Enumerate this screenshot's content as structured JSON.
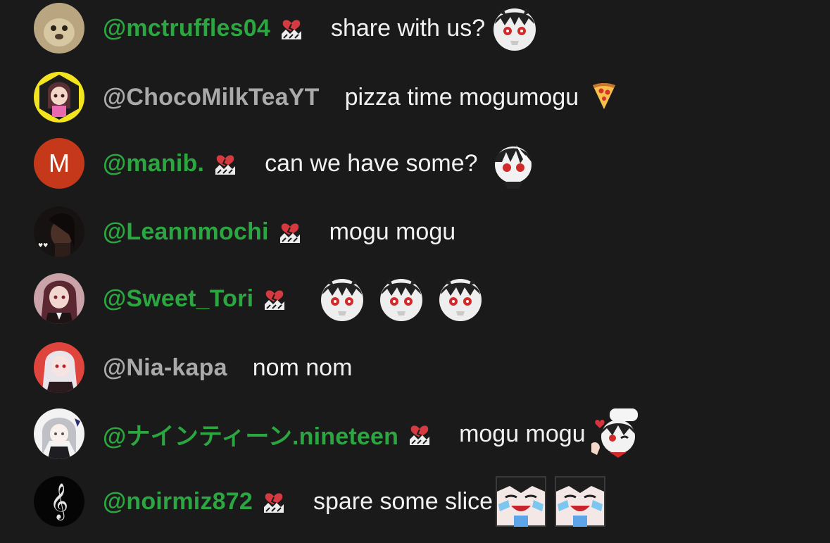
{
  "chat": {
    "messages": [
      {
        "author": "@mctruffles04",
        "author_style": "member",
        "has_badge": true,
        "text": "share with us?",
        "emojis": [
          "chibi-skull-emoji"
        ],
        "avatar": {
          "kind": "photo",
          "color": "#b9a57f"
        }
      },
      {
        "author": "@ChocoMilkTeaYT",
        "author_style": "plain",
        "has_badge": false,
        "text": "pizza time mogumogu",
        "emojis": [
          "pizza-emoji"
        ],
        "avatar": {
          "kind": "anime",
          "color": "#f2e41f"
        }
      },
      {
        "author": "@manib.",
        "author_style": "member",
        "has_badge": true,
        "text": "can we have some?",
        "emojis": [
          "chibi-face-emoji"
        ],
        "avatar": {
          "kind": "letter",
          "letter": "M",
          "color": "#c5391a"
        }
      },
      {
        "author": "@Leannmochi",
        "author_style": "member",
        "has_badge": true,
        "text": "mogu mogu",
        "emojis": [],
        "avatar": {
          "kind": "photo",
          "color": "#2a1c18"
        }
      },
      {
        "author": "@Sweet_Tori",
        "author_style": "member",
        "has_badge": true,
        "text": "",
        "emojis": [
          "chibi-skull-emoji",
          "chibi-skull-emoji",
          "chibi-skull-emoji"
        ],
        "avatar": {
          "kind": "anime",
          "color": "#7d3b3b"
        }
      },
      {
        "author": "@Nia-kapa",
        "author_style": "plain",
        "has_badge": false,
        "text": "nom nom",
        "emojis": [],
        "avatar": {
          "kind": "anime",
          "color": "#e0453d"
        }
      },
      {
        "author": "@ナインティーン.nineteen",
        "author_style": "member",
        "has_badge": true,
        "text": "mogu mogu",
        "emojis": [
          "chibi-chef-emoji"
        ],
        "avatar": {
          "kind": "anime",
          "color": "#cfd0d4"
        }
      },
      {
        "author": "@noirmiz872",
        "author_style": "member",
        "has_badge": true,
        "text": "spare some slice",
        "emojis": [
          "chibi-crying-emoji",
          "chibi-crying-emoji"
        ],
        "avatar": {
          "kind": "treble",
          "color": "#050505"
        }
      }
    ]
  },
  "colors": {
    "background": "#1a1a1a",
    "member_name": "#2ba640",
    "plain_name": "#aaaaaa",
    "message_text": "#f1f1f1"
  }
}
